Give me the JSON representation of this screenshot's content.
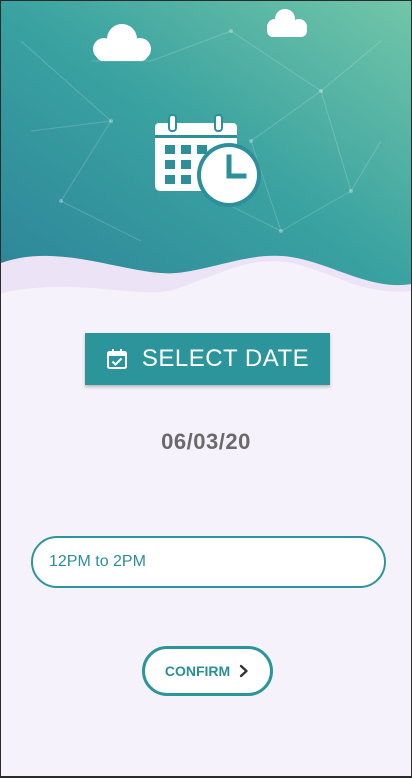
{
  "colors": {
    "accent": "#2c959b",
    "header_gradient_start": "#2d8a99",
    "header_gradient_end": "#6cc3a8",
    "background": "#f6f2fb",
    "date_text": "#6a6a6a"
  },
  "header": {
    "icons": [
      "cloud-icon",
      "cloud-icon",
      "calendar-clock-icon"
    ]
  },
  "select_date_button": {
    "icon": "calendar-check-icon",
    "label": "SELECT DATE"
  },
  "selected_date": "06/03/20",
  "time_slot": {
    "value": "12PM to 2PM"
  },
  "confirm_button": {
    "label": "CONFIRM",
    "icon": "chevron-right-icon"
  }
}
